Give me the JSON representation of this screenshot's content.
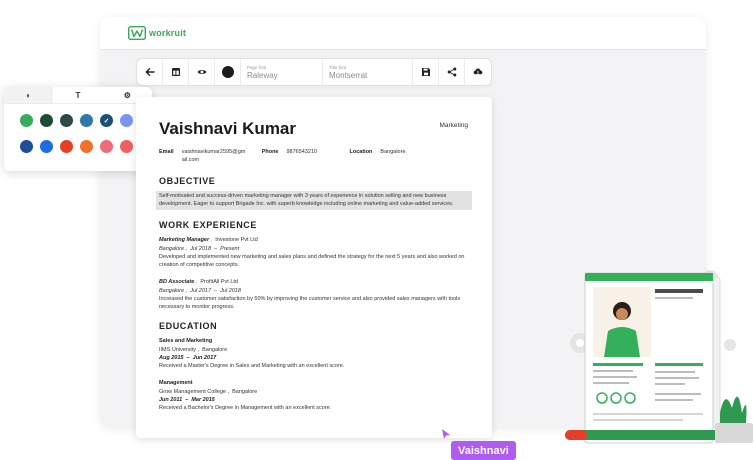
{
  "brand": {
    "name": "workruit",
    "color": "#3aa657"
  },
  "toolbar": {
    "back_icon": "arrow-left-icon",
    "layout_icon": "layout-icon",
    "preview_icon": "eye-icon",
    "color_icon": "color-dot",
    "page_font": {
      "label": "Page font",
      "value": "Raleway"
    },
    "title_font": {
      "label": "Title font",
      "value": "Montserrat"
    },
    "save_icon": "save-icon",
    "share_icon": "share-icon",
    "download_icon": "cloud-download-icon"
  },
  "style_panel": {
    "tabs": [
      {
        "icon": "contrast-icon",
        "label": "◐"
      },
      {
        "icon": "text-icon",
        "label": "T"
      },
      {
        "icon": "settings-icon",
        "label": "⚙"
      }
    ],
    "row1": [
      "#3aaa5f",
      "#1f4a34",
      "#2f4a45",
      "#2f78a8",
      "#1c4f78",
      "#7b96f0"
    ],
    "row2": [
      "#1f4f9b",
      "#1f6be0",
      "#e53f2b",
      "#f36f2b",
      "#f06b7a",
      "#f06060"
    ],
    "selected_index": 4,
    "check_label": "✓"
  },
  "resume": {
    "name": "Vaishnavi Kumar",
    "role": "Marketing",
    "contact": {
      "email_label": "Email",
      "email_line1": "vaishnavikumar2595@gm",
      "email_line2": "ail.com",
      "phone_label": "Phone",
      "phone": "9876543210",
      "location_label": "Location",
      "location": "Bangalore"
    },
    "objective_title": "OBJECTIVE",
    "objective": "Self-motivated and success-driven marketing manager with 3 years of experience in solution selling and new business development. Eager to support Brigade Inc. with superb knowledge including online marketing and value-added services.",
    "work_title": "WORK EXPERIENCE",
    "jobs": [
      {
        "title": "Marketing Manager",
        "company": "Investone Pvt Ltd",
        "city": "Bangalore",
        "start": "Jul 2018",
        "end": "Present",
        "desc": "Developed and implemented new marketing and sales plans and defined the strategy for the next 5 years and also worked on creation of competitive concepts."
      },
      {
        "title": "BD Associate",
        "company": "ProfitAll Pvt Ltd",
        "city": "Bangalore",
        "start": "Jul 2017",
        "end": "Jul 2018",
        "desc": "Increased the customer satisfaction by 50% by improving the customer service and also provided sales managers with tools necessary to monitor progress."
      }
    ],
    "education_title": "EDUCATION",
    "education": [
      {
        "degree": "Sales and Marketing",
        "school": "IIMS University",
        "city": "Bangalore",
        "start": "Aug 2015",
        "end": "Jun 2017",
        "desc": "Received a Master's Degree in Sales and Marketing with an excellent score."
      },
      {
        "degree": "Management",
        "school": "Grow Management College",
        "city": "Bangalore",
        "start": "Jun 2011",
        "end": "Mar 2015",
        "desc": "Received a Bachelor's Degree in Management with an excellent score."
      }
    ]
  },
  "cursor_label": "Vaishnavi",
  "cursor_color": "#b15cf0"
}
